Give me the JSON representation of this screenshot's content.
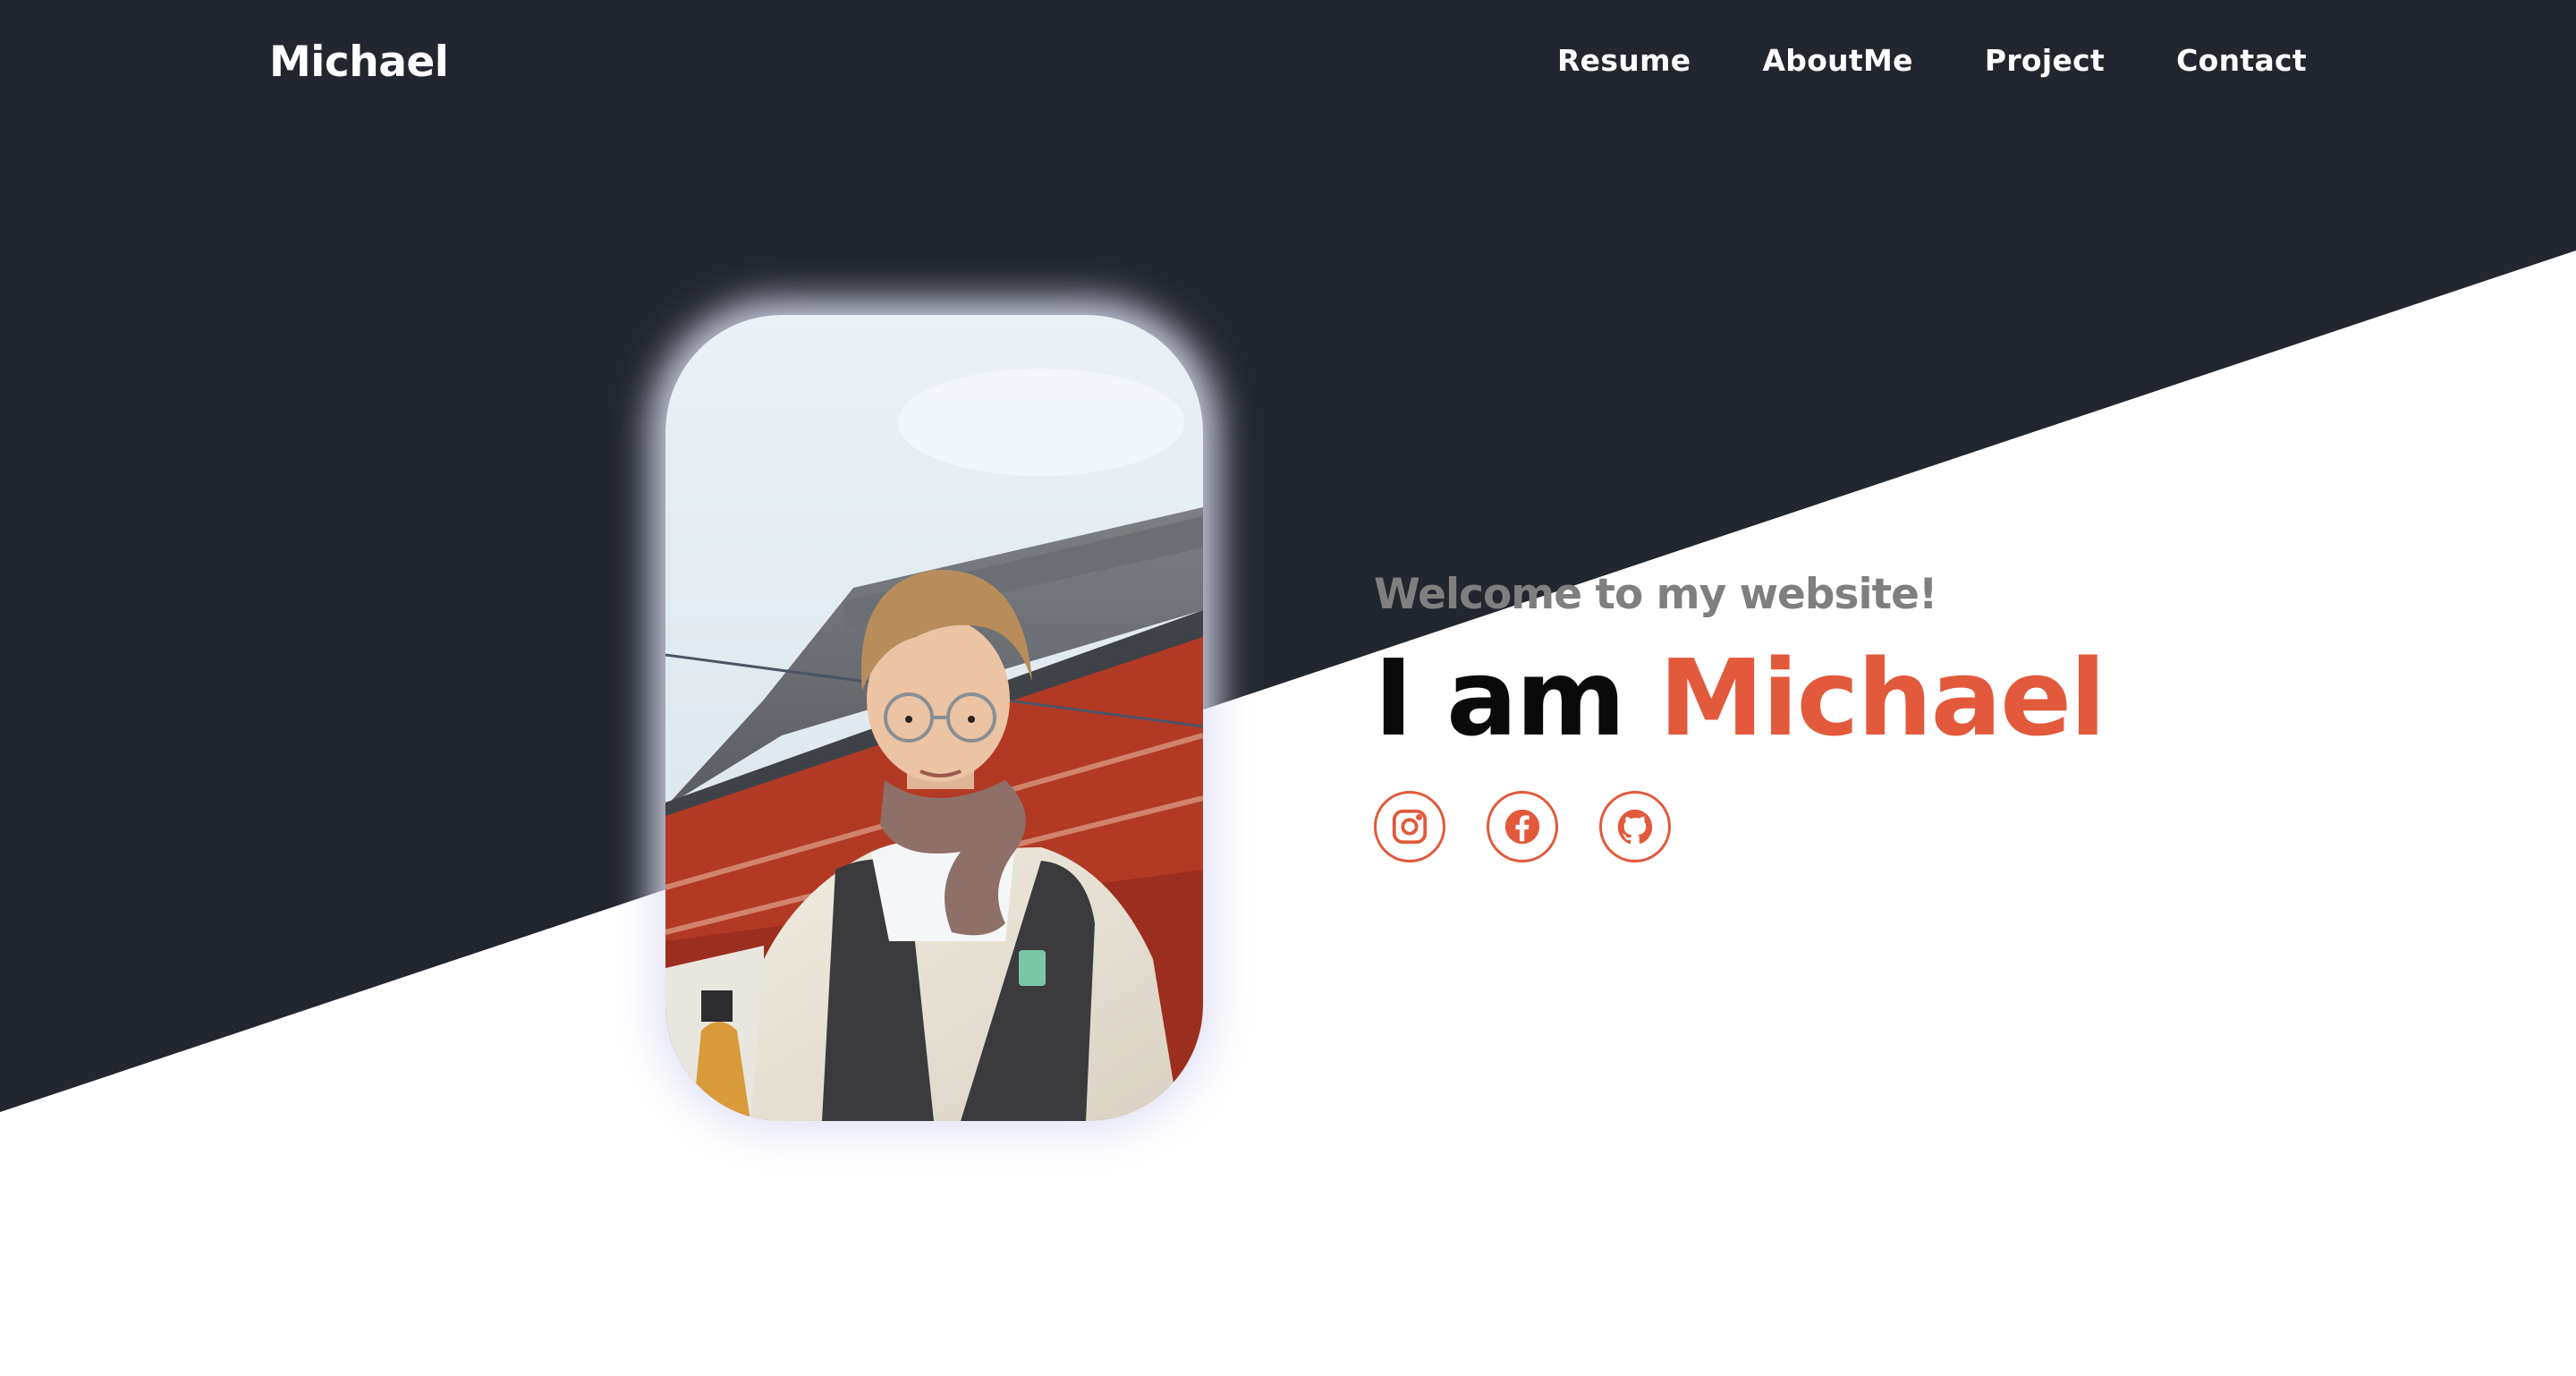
{
  "navbar": {
    "brand": "Michael",
    "links": [
      {
        "label": "Resume"
      },
      {
        "label": "AboutMe"
      },
      {
        "label": "Project"
      },
      {
        "label": "Contact"
      }
    ]
  },
  "hero": {
    "welcome": "Welcome to my website!",
    "headline_intro": "I am",
    "headline_name": "Michael",
    "socials": [
      {
        "icon": "instagram-icon"
      },
      {
        "icon": "facebook-icon"
      },
      {
        "icon": "github-icon"
      }
    ]
  },
  "colors": {
    "dark_bg": "#22262f",
    "accent": "#e2593b",
    "welcome_text": "#7f7f7f",
    "background": "#ffffff"
  }
}
